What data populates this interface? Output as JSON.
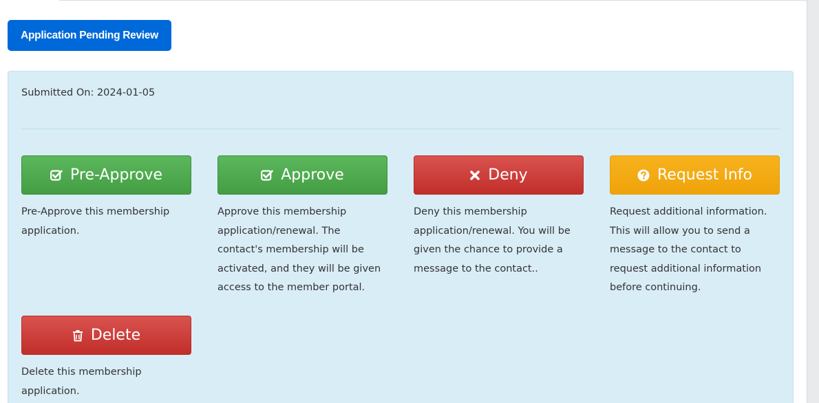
{
  "status_badge": {
    "label": "Application Pending Review",
    "color": "#0069d9"
  },
  "panel": {
    "submitted_label": "Submitted On: 2024-01-05",
    "background": "#d9edf7"
  },
  "actions": [
    {
      "label": "Pre-Approve",
      "icon": "check-square-icon",
      "color": "#5cb85c",
      "description": "Pre-Approve this membership application."
    },
    {
      "label": "Approve",
      "icon": "check-square-icon",
      "color": "#5cb85c",
      "description": "Approve this membership application/renewal. The contact's membership will be activated, and they will be given access to the member portal."
    },
    {
      "label": "Deny",
      "icon": "times-icon",
      "color": "#d9534f",
      "description": "Deny this membership application/renewal. You will be given the chance to provide a message to the contact.."
    },
    {
      "label": "Request Info",
      "icon": "question-circle-icon",
      "color": "#f0ad0e",
      "description": "Request additional information. This will allow you to send a message to the contact to request additional information before continuing."
    },
    {
      "label": "Delete",
      "icon": "trash-icon",
      "color": "#d9534f",
      "description": "Delete this membership application."
    }
  ]
}
